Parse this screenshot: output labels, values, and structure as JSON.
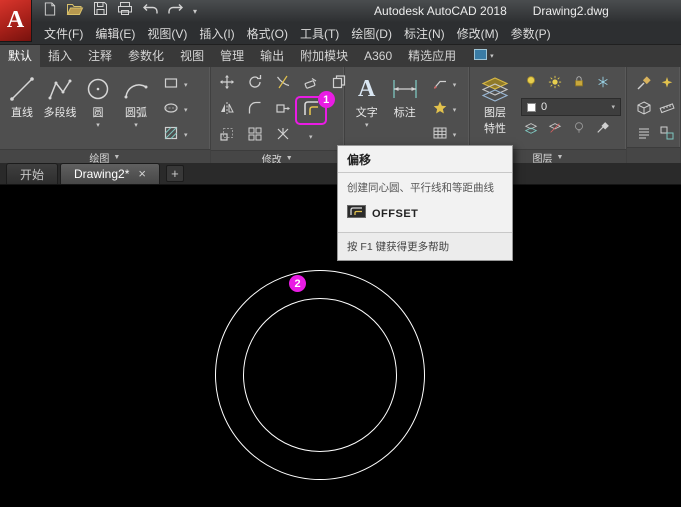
{
  "colors": {
    "highlight_magenta": "#e91ce4",
    "canvas_background": "#000000",
    "circle_outline": "#ffffff",
    "ribbon_background": "#4f4f4f",
    "tooltip_background": "#f2f2f2"
  },
  "title_bar": {
    "logo_letter": "A",
    "app_title": "Autodesk AutoCAD 2018",
    "doc_title": "Drawing2.dwg"
  },
  "menu_bar": {
    "items": [
      "文件(F)",
      "编辑(E)",
      "视图(V)",
      "插入(I)",
      "格式(O)",
      "工具(T)",
      "绘图(D)",
      "标注(N)",
      "修改(M)",
      "参数(P)"
    ]
  },
  "ribbon": {
    "tabs": [
      "默认",
      "插入",
      "注释",
      "参数化",
      "视图",
      "管理",
      "输出",
      "附加模块",
      "A360",
      "精选应用"
    ],
    "active_tab": "默认",
    "draw": {
      "line": "直线",
      "polyline": "多段线",
      "circle": "圆",
      "arc": "圆弧",
      "footer": "绘图"
    },
    "modify": {
      "footer": "修改"
    },
    "annotate": {
      "text": "文字",
      "dimension": "标注"
    },
    "layers": {
      "properties_line1": "图层",
      "properties_line2": "特性",
      "current_layer": "0",
      "footer": "图层"
    }
  },
  "file_tabs": {
    "start": "开始",
    "drawing": "Drawing2*"
  },
  "tooltip": {
    "title": "偏移",
    "description": "创建同心圆、平行线和等距曲线",
    "command": "OFFSET",
    "footer": "按 F1 键获得更多帮助"
  },
  "badges": {
    "step1": "1",
    "step2": "2"
  },
  "glyphs": {
    "caret": "▼",
    "caret_small": "▾",
    "close": "×",
    "plus": "+",
    "text_tool": "A"
  }
}
